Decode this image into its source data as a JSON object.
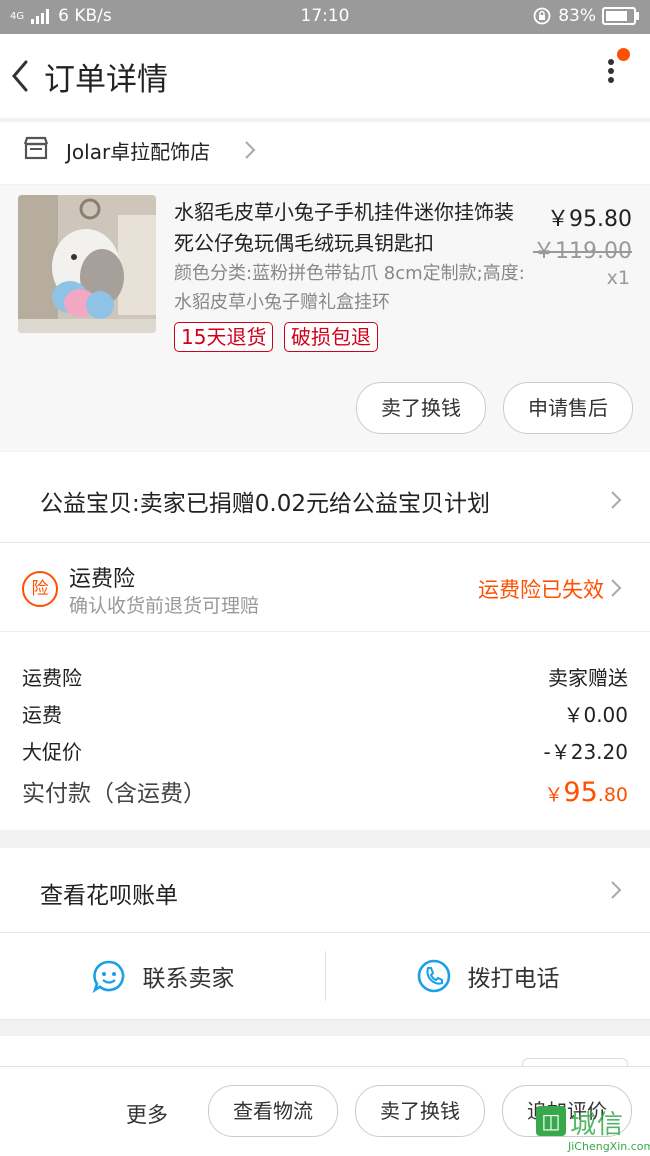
{
  "status_bar": {
    "network": "4G",
    "speed": "6 KB/s",
    "time": "17:10",
    "battery": "83%"
  },
  "header": {
    "title": "订单详情"
  },
  "store": {
    "name": "Jolar卓拉配饰店"
  },
  "item": {
    "title": "水貂毛皮草小兔子手机挂件迷你挂饰装死公仔兔玩偶毛绒玩具钥匙扣",
    "sku": "颜色分类:蓝粉拼色带钻爪 8cm定制款;高度:水貂皮草小兔子赠礼盒挂环",
    "price": "￥95.80",
    "original_price": "￥119.00",
    "quantity": "x1",
    "tags": [
      "15天退货",
      "破损包退"
    ],
    "actions": [
      "卖了换钱",
      "申请售后"
    ]
  },
  "donation": {
    "text": "公益宝贝:卖家已捐赠0.02元给公益宝贝计划"
  },
  "insurance": {
    "icon_text": "险",
    "title": "运费险",
    "subtitle": "确认收货前退货可理赔",
    "status": "运费险已失效"
  },
  "summary": {
    "rows": [
      {
        "label": "运费险",
        "value": "卖家赠送"
      },
      {
        "label": "运费",
        "value": "￥0.00"
      },
      {
        "label": "大促价",
        "value": "-￥23.20"
      }
    ],
    "total_label": "实付款（含运费）",
    "total_currency": "￥",
    "total_int": "95",
    "total_dec": ".80"
  },
  "huabei": {
    "text": "查看花呗账单"
  },
  "contact": {
    "seller": "联系卖家",
    "phone": "拨打电话"
  },
  "bottom_bar": {
    "more": "更多",
    "buttons": [
      "查看物流",
      "卖了换钱",
      "追加评价"
    ]
  },
  "watermark": {
    "cn": "城信",
    "en": "JiChengXin.com"
  },
  "colors": {
    "accent": "#ff5000",
    "tag_red": "#d0021b",
    "contact_blue": "#1aa1e5"
  }
}
